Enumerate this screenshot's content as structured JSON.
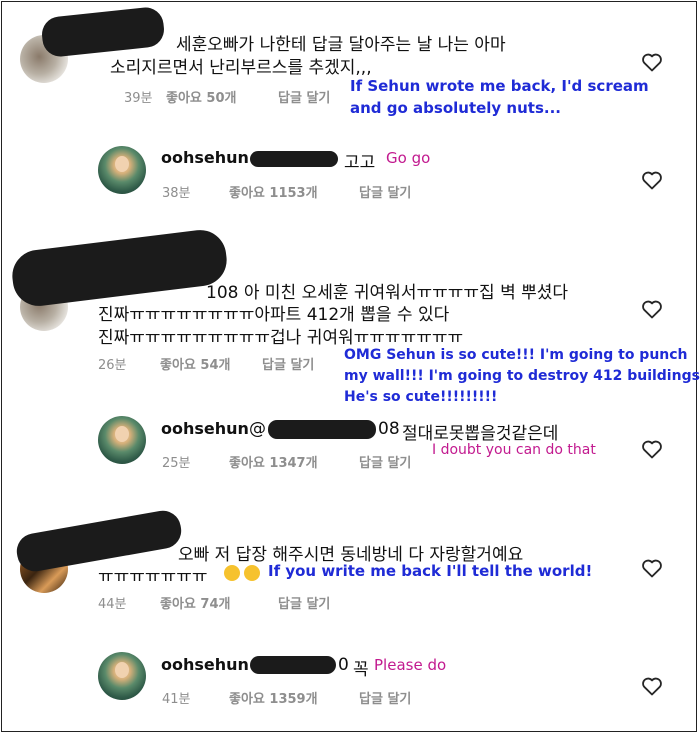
{
  "comments": [
    {
      "text_line1": "세훈오빠가 나한테 답글 달아주는 날 나는 아마",
      "text_line2": "소리지르면서 난리부르스를 추겠지,,,",
      "time": "39분",
      "likes": "좋아요 50개",
      "reply_label": "답글 달기",
      "translation": "If Sehun wrote me back, I'd scream and go absolutely nuts...",
      "translation_line1": "If Sehun wrote me back, I'd scream",
      "translation_line2": "and go absolutely nuts...",
      "reply": {
        "handle": "oohsehun",
        "text": "고고",
        "translation": "Go go",
        "time": "38분",
        "likes": "좋아요 1153개",
        "reply_label": "답글 달기"
      }
    },
    {
      "text_line1": "108 아 미친 오세훈 귀여워서ㅠㅠㅠㅠ집 벽 뿌셨다",
      "text_line2": "진짜ㅠㅠㅠㅠㅠㅠㅠㅠ아파트 412개 뽑을 수 있다",
      "text_line3": "진짜ㅠㅠㅠㅠㅠㅠㅠㅠㅠ겁나 귀여워ㅠㅠㅠㅠㅠㅠㅠ",
      "time": "26분",
      "likes": "좋아요 54개",
      "reply_label": "답글 달기",
      "translation_line1": "OMG Sehun is so cute!!! I'm going to punch",
      "translation_line2": "my wall!!! I'm going to destroy 412 buildings",
      "translation_line3": "He's so cute!!!!!!!!!",
      "reply": {
        "handle": "oohsehun",
        "mention_prefix": "@",
        "mention_suffix": "08",
        "text": "절대로못뽑을것같은데",
        "translation": "I doubt you can do that",
        "time": "25분",
        "likes": "좋아요 1347개",
        "reply_label": "답글 달기"
      }
    },
    {
      "text_line1": "오빠 저 답장 해주시면 동네방네 다 자랑할거예요",
      "text_line2": "ㅠㅠㅠㅠㅠㅠㅠ",
      "translation": "If you write me back I'll tell the world!",
      "time": "44분",
      "likes": "좋아요 74개",
      "reply_label": "답글 달기",
      "reply": {
        "handle": "oohsehun",
        "mention_suffix": "0",
        "text": "꼭",
        "translation": "Please do",
        "time": "41분",
        "likes": "좋아요 1359개",
        "reply_label": "답글 달기"
      }
    }
  ],
  "icons": {
    "like": "heart-outline-icon",
    "emoji": "crying-face-emoji"
  },
  "colors": {
    "translation_blue": "#1f2bd6",
    "translation_pink": "#c21a8f",
    "meta_gray": "#8e8e8e"
  }
}
